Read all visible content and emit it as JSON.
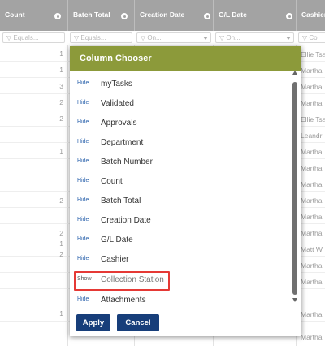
{
  "columns": {
    "count": "Count",
    "batch_total": "Batch Total",
    "creation_date": "Creation Date",
    "gl_date": "G/L Date",
    "cashier": "Cashier"
  },
  "filters": {
    "count": "Equals...",
    "batch_total": "Equals...",
    "creation_date": "On...",
    "gl_date": "On...",
    "cashier": "Co"
  },
  "rows": [
    {
      "count": "1",
      "cashier": "Ellie Tsa"
    },
    {
      "count": "1",
      "cashier": "Martha"
    },
    {
      "count": "3",
      "cashier": "Martha"
    },
    {
      "count": "2",
      "cashier": "Martha"
    },
    {
      "count": "2",
      "cashier": "Ellie Tsa"
    },
    {
      "count": "",
      "cashier": "Leandr"
    },
    {
      "count": "1",
      "cashier": "Martha"
    },
    {
      "count": "",
      "cashier": "Martha"
    },
    {
      "count": "2",
      "cashier": "Martha"
    },
    {
      "count": "",
      "cashier": "Martha"
    },
    {
      "count": "2",
      "cashier": "Martha"
    },
    {
      "count": "1",
      "cashier": "Martha"
    },
    {
      "count": "2",
      "cashier": "Matt W"
    },
    {
      "count": "",
      "cashier": "Martha"
    },
    {
      "count": "",
      "cashier": "Martha"
    },
    {
      "count": "1",
      "cashier": "Martha"
    },
    {
      "count": "",
      "cashier": "Martha"
    }
  ],
  "chooser": {
    "title": "Column Chooser",
    "items": [
      {
        "action": "Hide",
        "label": "myTasks"
      },
      {
        "action": "Hide",
        "label": "Validated"
      },
      {
        "action": "Hide",
        "label": "Approvals"
      },
      {
        "action": "Hide",
        "label": "Department"
      },
      {
        "action": "Hide",
        "label": "Batch Number"
      },
      {
        "action": "Hide",
        "label": "Count"
      },
      {
        "action": "Hide",
        "label": "Batch Total"
      },
      {
        "action": "Hide",
        "label": "Creation Date"
      },
      {
        "action": "Hide",
        "label": "G/L Date"
      },
      {
        "action": "Hide",
        "label": "Cashier"
      },
      {
        "action": "Show",
        "label": "Collection Station"
      },
      {
        "action": "Hide",
        "label": "Attachments"
      }
    ],
    "apply": "Apply",
    "cancel": "Cancel"
  },
  "colors": {
    "header_bg": "#a3a3a3",
    "dialog_header": "#8c9a3a",
    "button_bg": "#173e7a",
    "link": "#2d64ad",
    "highlight": "#e53935"
  }
}
